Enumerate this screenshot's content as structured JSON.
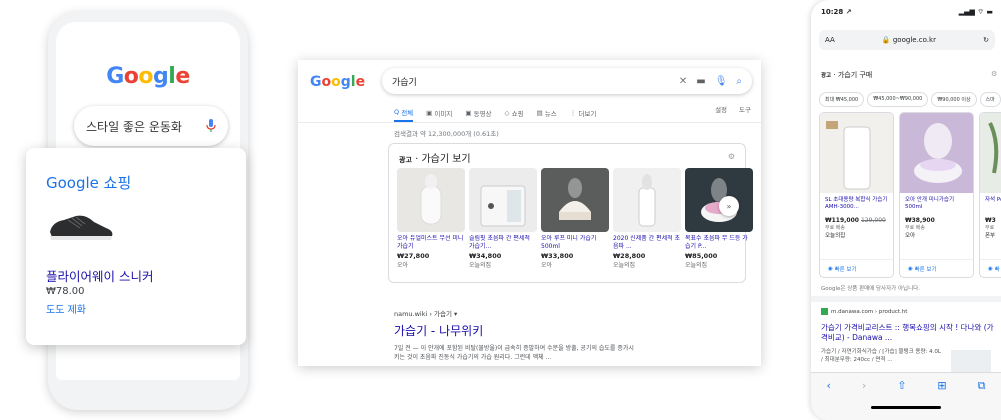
{
  "left_phone": {
    "logo": "Google",
    "search_query": "스타일 좋은 운동화",
    "shopping_card": {
      "title": "Google 쇼핑",
      "product_name": "플라이어웨이 스니커",
      "price": "₩78.00",
      "store": "도도 제화"
    }
  },
  "desktop": {
    "logo": "Google",
    "search_query": "가습기",
    "tabs": [
      "전체",
      "이미지",
      "동영상",
      "쇼핑",
      "뉴스",
      "더보기"
    ],
    "tab_icons": [
      "Q",
      "▣",
      "▣",
      "◇",
      "▤",
      "⋮"
    ],
    "tabs_right": [
      "설정",
      "도구"
    ],
    "stats": "검색결과 약 12,300,000개 (0.61초)",
    "ad": {
      "tag": "광고",
      "title": "가습기 보기",
      "products": [
        {
          "name": "오아 듀얼미스트 무선 미니 가습기",
          "price": "₩27,800",
          "store": "오아"
        },
        {
          "name": "슬림핏 초음파 간 편세척 가습기...",
          "price": "₩34,800",
          "store": "오늘의집"
        },
        {
          "name": "오아 루프 미니 가습기 500ml",
          "price": "₩33,800",
          "store": "오아"
        },
        {
          "name": "2020 신제품 간 편세척 초음파 ...",
          "price": "₩28,800",
          "store": "오늘의집"
        },
        {
          "name": "복표수 초음파 무 드등 가습기 P...",
          "price": "₩85,000",
          "store": "오늘의집"
        }
      ]
    },
    "organic": {
      "url": "namu.wiki › 가습기 ▾",
      "title": "가습기 - 나무위키",
      "snippet1": "7일 전 — 이 안개에 포함된 비탈(물방울)이 급속히 증발하여 수분을 방출, 공기의 습도를 증가시",
      "snippet2": "키는 것이 초음파 진동식 가습기의 가습 원리다. 그런데 액체 ..."
    }
  },
  "right_phone": {
    "time": "10:28 ↗",
    "status_right": "▂▄▆ ⌔ ▬",
    "url_aa": "AA",
    "url": "🔒 google.co.kr",
    "reload": "↻",
    "ad_tag": "광고",
    "ad_title": "가습기 구매",
    "chips": [
      "최대 ₩45,000",
      "₩45,000~₩90,000",
      "₩90,000 이상",
      "스마"
    ],
    "products": [
      {
        "name": "SL 초대용량 복합식 가습기 AMH-3000...",
        "price": "₩119,000",
        "old": "129,000",
        "sub": "무료 배송",
        "store": "오늘의집",
        "btn": "빠른 보기"
      },
      {
        "name": "오아 안개 미니가습기 500ml",
        "price": "₩38,900",
        "old": "",
        "sub": "무료 배송",
        "store": "오아",
        "btn": "빠른 보기"
      },
      {
        "name": "자석 Pop",
        "price": "₩3",
        "old": "",
        "sub": "무료",
        "store": "폰부",
        "btn": "빠"
      }
    ],
    "note": "Google은 상품 판매에 당사자가 아닙니다.",
    "organic": {
      "url": "m.danawa.com › product.ht",
      "title": "가습기 가격비교리스트 :: 행복쇼핑의 시작 ! 다나와 (가격비교) - Danawa ...",
      "desc": "가습기 / 자연기화식가습 / [가습] 물탱크 용량: 4.0L / 최대분무량: 240cc / 면적 ..."
    },
    "nav": [
      "‹",
      "›",
      "⇧",
      "⊞",
      "⧉"
    ]
  }
}
